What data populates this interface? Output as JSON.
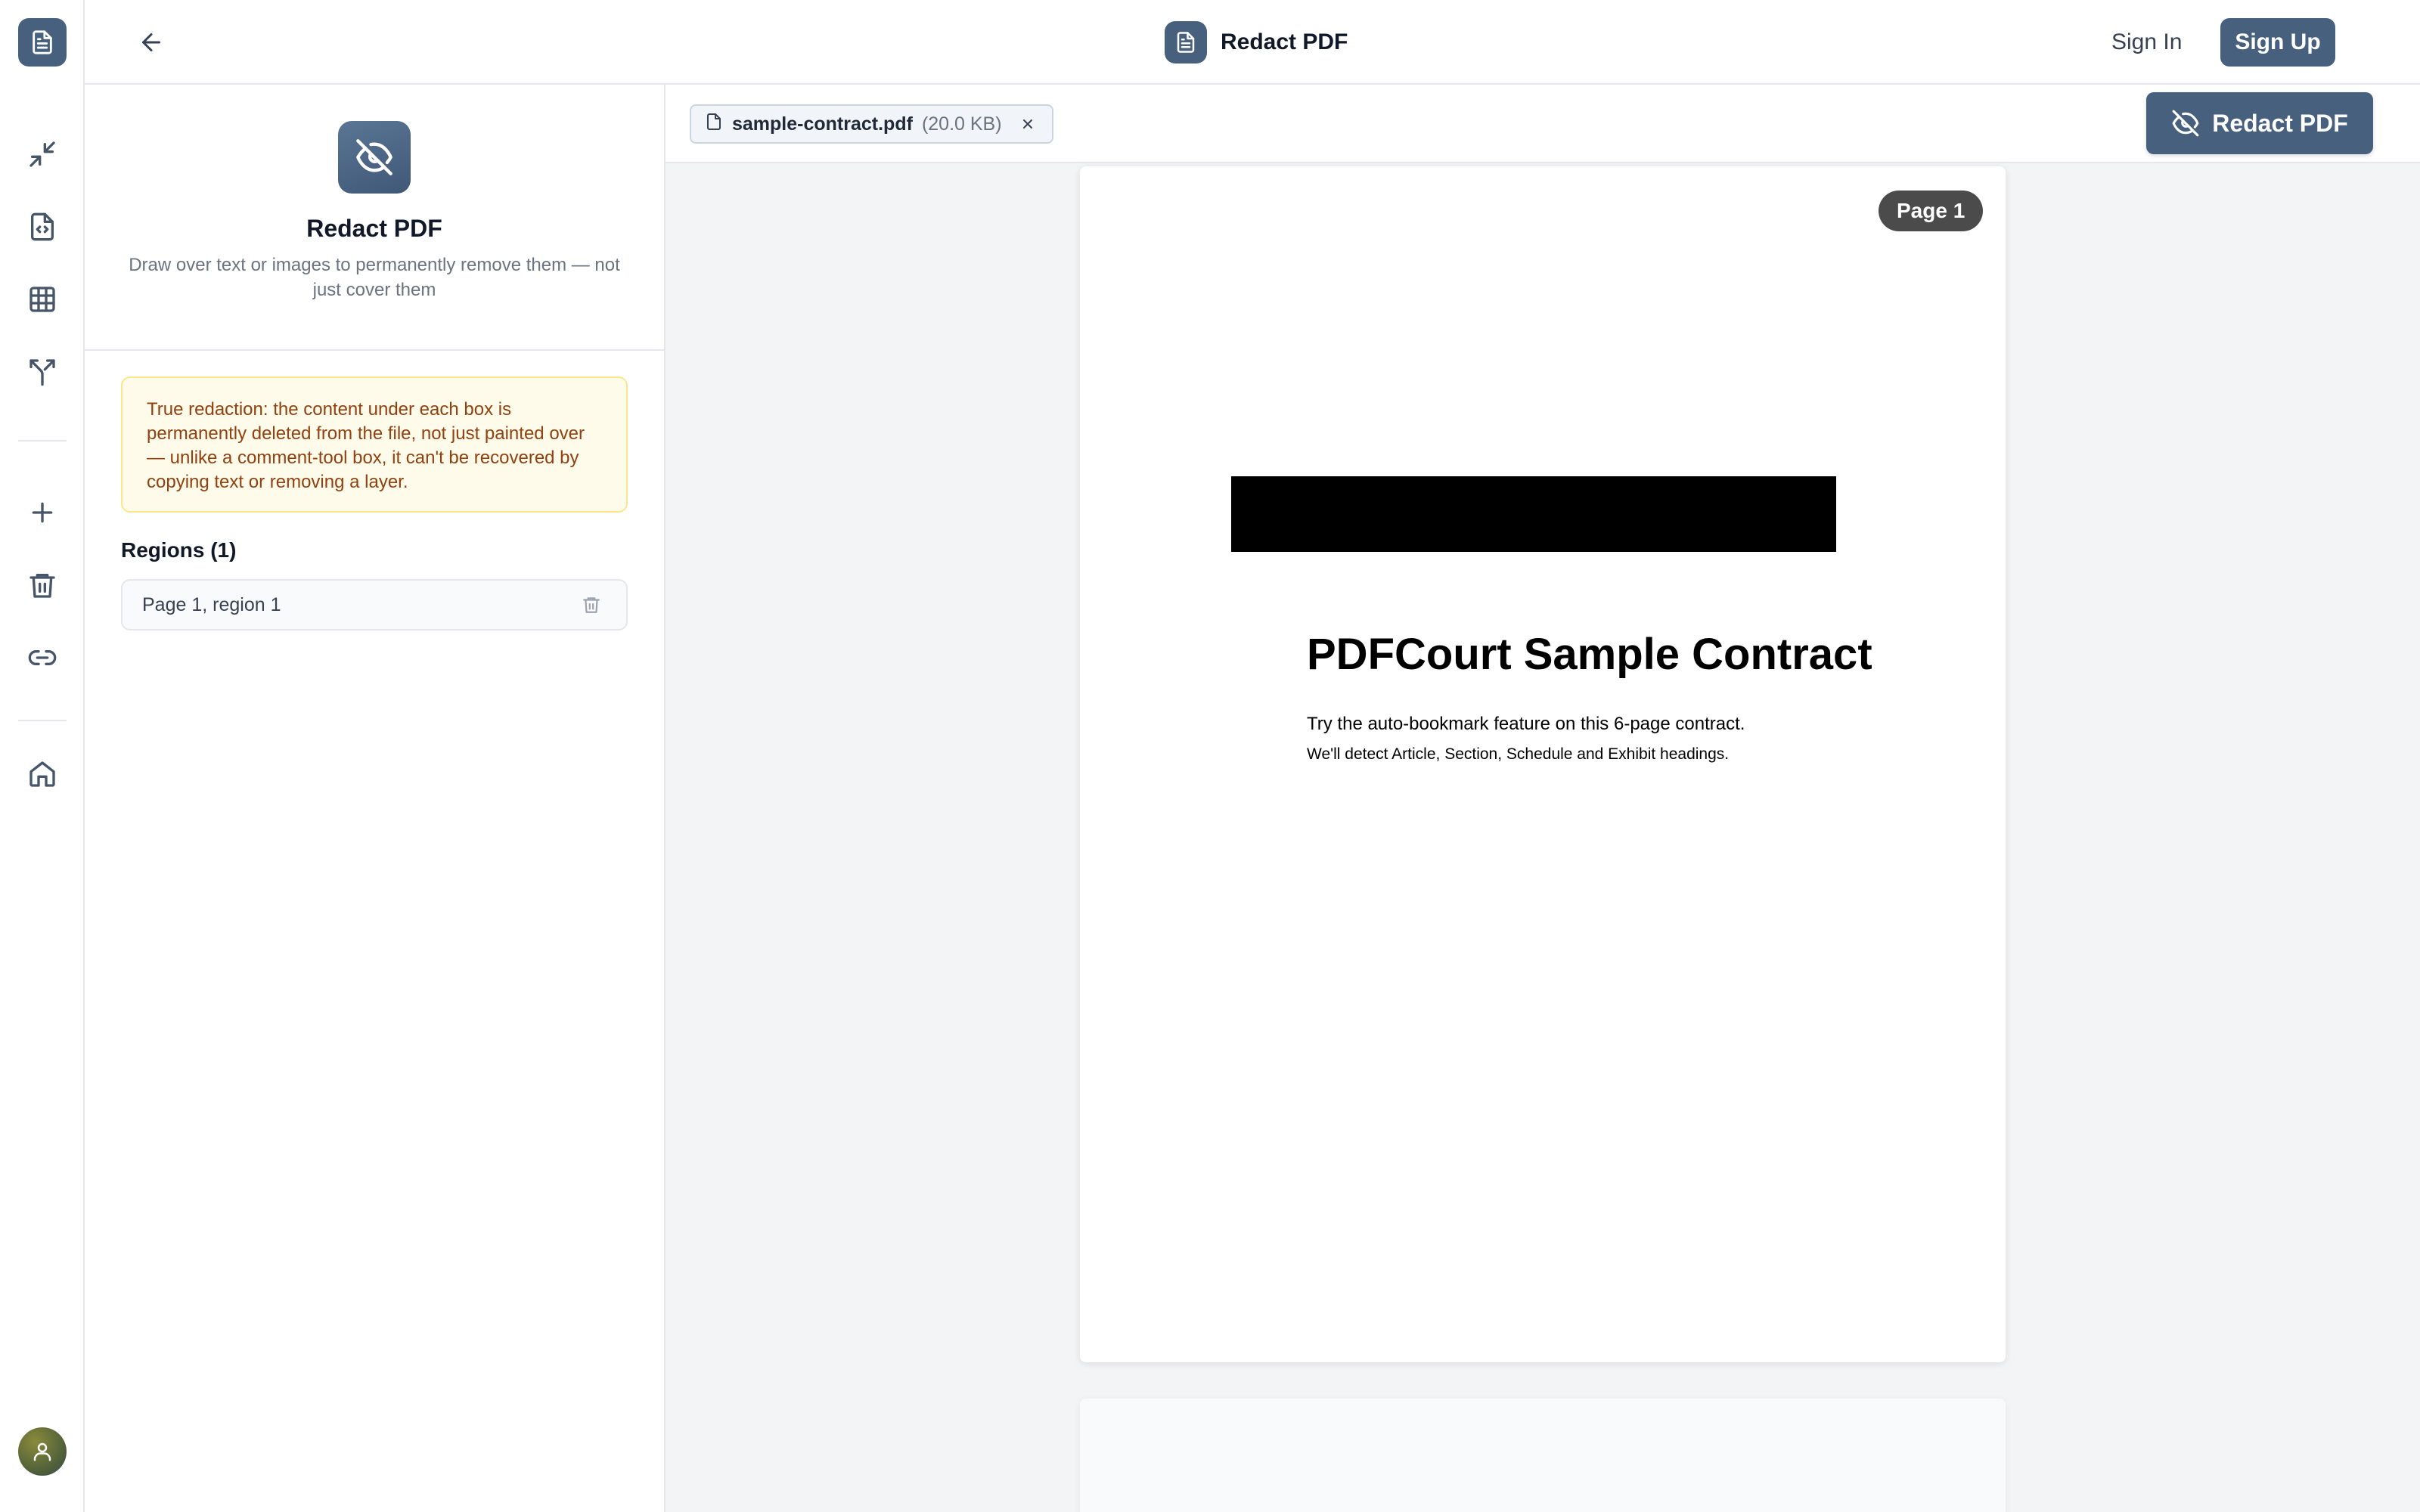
{
  "header": {
    "title": "Redact PDF",
    "sign_in": "Sign In",
    "sign_up": "Sign Up"
  },
  "rail": {
    "items": [
      "compress-icon",
      "file-code-icon",
      "table-icon",
      "split-icon",
      "plus-icon",
      "trash-icon",
      "link-icon",
      "home-icon"
    ]
  },
  "panel": {
    "title": "Redact PDF",
    "description": "Draw over text or images to permanently remove them — not just cover them",
    "notice": "True redaction: the content under each box is permanently deleted from the file, not just painted over — unlike a comment-tool box, it can't be recovered by copying text or removing a layer.",
    "regions_label": "Regions (1)",
    "regions": [
      {
        "label": "Page 1, region 1"
      }
    ]
  },
  "toolbar": {
    "file_name": "sample-contract.pdf",
    "file_size": "(20.0 KB)",
    "redact_button": "Redact PDF"
  },
  "document": {
    "page_badge": "Page 1",
    "title": "PDFCourt Sample Contract",
    "line1": "Try the auto-bookmark feature on this 6-page contract.",
    "line2": "We'll detect Article, Section, Schedule and Exhibit headings."
  },
  "colors": {
    "accent": "#46607e",
    "notice_bg": "#fffbeb",
    "notice_text": "#92400e"
  }
}
